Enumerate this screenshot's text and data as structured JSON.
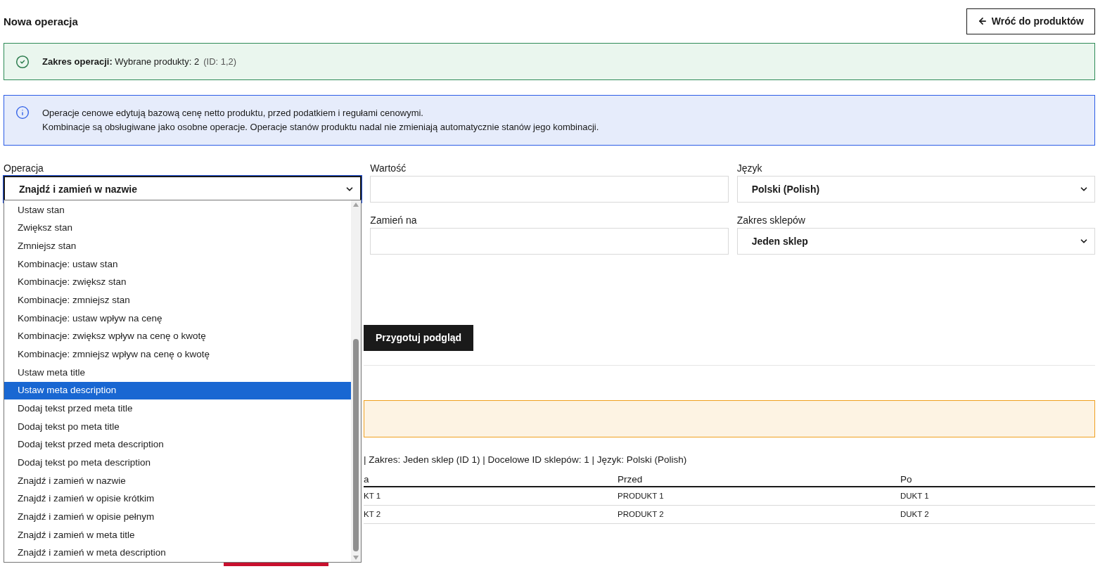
{
  "page": {
    "title": "Nowa operacja",
    "back_button": "Wróć do produktów"
  },
  "scope_alert": {
    "label": "Zakres operacji:",
    "text": "Wybrane produkty: 2",
    "ids": "(ID: 1,2)"
  },
  "info_alert": {
    "lines": [
      "Operacje cenowe edytują bazową cenę netto produktu, przed podatkiem i regułami cenowymi.",
      "Kombinacje są obsługiwane jako osobne operacje. Operacje stanów produktu nadal nie zmieniają automatycznie stanów jego kombinacji."
    ]
  },
  "form": {
    "rows": [
      [
        {
          "kind": "select",
          "label": "Operacja",
          "value": "Znajdź i zamień w nazwie",
          "focused": true
        },
        {
          "kind": "input",
          "label": "Wartość",
          "focused": false
        },
        {
          "kind": "select",
          "label": "Język",
          "value": "Polski (Polish)",
          "focused": false
        }
      ],
      [
        {
          "kind": "hidden"
        },
        {
          "kind": "input",
          "label": "Zamień na",
          "focused": false
        },
        {
          "kind": "select",
          "label": "Zakres sklepów",
          "value": "Jeden sklep",
          "focused": false
        }
      ]
    ]
  },
  "dropdown": {
    "options": [
      {
        "label": "Ustaw stan",
        "selected": false
      },
      {
        "label": "Zwiększ stan",
        "selected": false
      },
      {
        "label": "Zmniejsz stan",
        "selected": false
      },
      {
        "label": "Kombinacje: ustaw stan",
        "selected": false
      },
      {
        "label": "Kombinacje: zwiększ stan",
        "selected": false
      },
      {
        "label": "Kombinacje: zmniejsz stan",
        "selected": false
      },
      {
        "label": "Kombinacje: ustaw wpływ na cenę",
        "selected": false
      },
      {
        "label": "Kombinacje: zwiększ wpływ na cenę o kwotę",
        "selected": false
      },
      {
        "label": "Kombinacje: zmniejsz wpływ na cenę o kwotę",
        "selected": false
      },
      {
        "label": "Ustaw meta title",
        "selected": false
      },
      {
        "label": "Ustaw meta description",
        "selected": true
      },
      {
        "label": "Dodaj tekst przed meta title",
        "selected": false
      },
      {
        "label": "Dodaj tekst po meta title",
        "selected": false
      },
      {
        "label": "Dodaj tekst przed meta description",
        "selected": false
      },
      {
        "label": "Dodaj tekst po meta description",
        "selected": false
      },
      {
        "label": "Znajdź i zamień w nazwie",
        "selected": false
      },
      {
        "label": "Znajdź i zamień w opisie krótkim",
        "selected": false
      },
      {
        "label": "Znajdź i zamień w opisie pełnym",
        "selected": false
      },
      {
        "label": "Znajdź i zamień w meta title",
        "selected": false
      },
      {
        "label": "Znajdź i zamień w meta description",
        "selected": false
      }
    ]
  },
  "preview_button": "Przygotuj podgląd",
  "summary": "| Zakres: Jeden sklep (ID 1) | Docelowe ID sklepów: 1 | Język: Polski (Polish)",
  "table": {
    "columns": [
      "a",
      "Przed",
      "Po"
    ],
    "rows": [
      [
        "KT 1",
        "PRODUKT 1",
        "DUKT 1"
      ],
      [
        "KT 2",
        "PRODUKT 2",
        "DUKT 2"
      ]
    ]
  }
}
